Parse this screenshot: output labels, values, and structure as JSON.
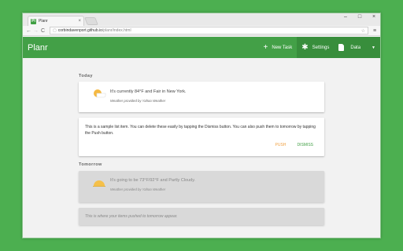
{
  "browser": {
    "tab_title": "Planr",
    "tab_favicon": "Pl",
    "tab_close_icon": "×",
    "url_host": "corbindavenport.github.io",
    "url_path": "/planr/index.html",
    "window_controls": [
      "–",
      "□",
      "×"
    ],
    "nav_icons": {
      "back": "←",
      "forward": "→",
      "reload": "C",
      "page": "▢",
      "star": "☆",
      "menu": "≡"
    }
  },
  "app": {
    "title": "Planr",
    "actions": [
      {
        "label": "New Task",
        "icon": "+"
      },
      {
        "label": "Settings",
        "icon": "✱"
      },
      {
        "label": "Data",
        "icon": "doc-icon"
      }
    ],
    "data_caret": "▼",
    "accent_color": "#43a047"
  },
  "today": {
    "label": "Today",
    "weather": "It's currently 84°F and Fair in New York.",
    "weather_credit": "Weather provided by Yahoo Weather",
    "note": "This is a sample list item. You can delete these easily by tapping the Dismiss button. You can also push them to tomorrow by tapping the Push button.",
    "push_label": "PUSH",
    "dismiss_label": "DISMISS"
  },
  "tomorrow": {
    "label": "Tomorrow",
    "weather": "It's going to be 73°F/92°F and Partly Cloudy.",
    "weather_credit": "Weather provided by Yahoo Weather",
    "empty_message": "This is where your items pushed to tomorrow appear."
  }
}
